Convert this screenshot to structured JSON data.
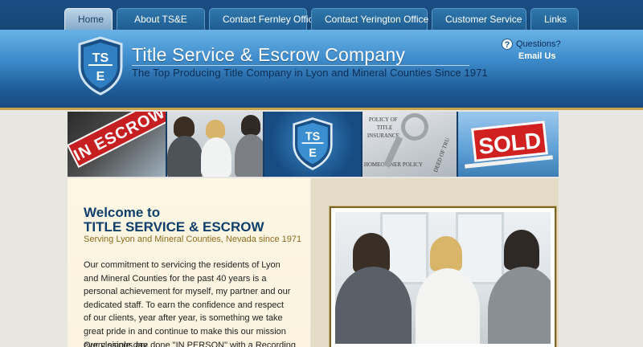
{
  "nav": {
    "tabs": [
      {
        "label": "Home",
        "active": true
      },
      {
        "label": "About TS&E"
      },
      {
        "label": "Contact Fernley Office"
      },
      {
        "label": "Contact Yerington Office"
      },
      {
        "label": "Customer Service"
      },
      {
        "label": "Links"
      }
    ]
  },
  "header": {
    "logo_letters_top": "TS",
    "logo_letters_bottom": "E",
    "title": "Title Service & Escrow Company",
    "tagline": "The Top Producing Title Company in Lyon and Mineral Counties Since 1971",
    "questions_label": "Questions?",
    "email_label": "Email Us"
  },
  "strip": {
    "escrow_sign": "IN ESCROW",
    "sold_sign": "SOLD",
    "doc_text_1": "POLICY OF",
    "doc_text_2": "TITLE",
    "doc_text_3": "INSURANCE",
    "doc_text_4": "HOMEOWNER POLICY",
    "doc_text_5": "DEED OF TRU"
  },
  "welcome": {
    "heading_line1": "Welcome to",
    "heading_line2": "TITLE SERVICE & ESCROW",
    "subheading": "Serving Lyon and Mineral Counties, Nevada since 1971",
    "body": "Our commitment to servicing the residents of Lyon and Mineral Counties for the past 40 years is a personal achievement for myself, my partner and our dedicated staff. To earn the confidence and respect of our clients, year after year, is something we take great pride in and continue to make this our mission every single day.",
    "more": "Our closings are done \"IN PERSON\" with a Recording"
  },
  "colors": {
    "nav_bg": "#1a4e83",
    "header_top": "#68b2e6",
    "header_bottom": "#174b7f",
    "gold_accent": "#c8a44e",
    "heading_blue": "#0e3f6c",
    "subheading_gold": "#8c6b1d"
  }
}
